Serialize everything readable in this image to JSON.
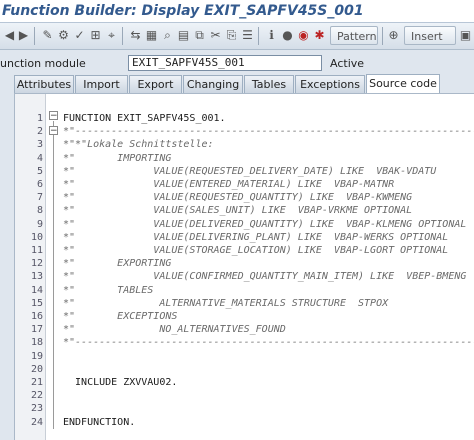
{
  "window": {
    "title": "Function Builder: Display EXIT_SAPFV45S_001"
  },
  "toolbar": {
    "icons": [
      "back-arrow-icon",
      "forward-arrow-icon",
      "display-change-icon",
      "activate-icon",
      "check-icon",
      "object-list-icon",
      "where-used-icon",
      "navigate-icon",
      "pretty-printer-icon",
      "find-icon",
      "insert-statement-icon",
      "copy-icon",
      "cut-icon",
      "paste-icon",
      "stack-icon",
      "info-icon",
      "breakpoint-icon",
      "watchpoint-icon",
      "enhance-icon"
    ],
    "pattern_label": "Pattern",
    "insert_label": "Insert"
  },
  "function_module": {
    "label": "unction module",
    "value": "EXIT_SAPFV45S_001",
    "status": "Active"
  },
  "tabs": [
    {
      "label": "Attributes",
      "active": false
    },
    {
      "label": "Import",
      "active": false
    },
    {
      "label": "Export",
      "active": false
    },
    {
      "label": "Changing",
      "active": false
    },
    {
      "label": "Tables",
      "active": false
    },
    {
      "label": "Exceptions",
      "active": false
    },
    {
      "label": "Source code",
      "active": true
    }
  ],
  "editor": {
    "lines": [
      {
        "n": "1",
        "text": "FUNCTION EXIT_SAPFV45S_001.",
        "type": "kw"
      },
      {
        "n": "2",
        "text": "*\"-------------------------------------------------------------------",
        "type": "comment"
      },
      {
        "n": "3",
        "text": "*\"*\"Lokale Schnittstelle:",
        "type": "comment"
      },
      {
        "n": "4",
        "text": "*\"       IMPORTING",
        "type": "comment"
      },
      {
        "n": "5",
        "text": "*\"             VALUE(REQUESTED_DELIVERY_DATE) LIKE  VBAK-VDATU",
        "type": "comment"
      },
      {
        "n": "6",
        "text": "*\"             VALUE(ENTERED_MATERIAL) LIKE  VBAP-MATNR",
        "type": "comment"
      },
      {
        "n": "7",
        "text": "*\"             VALUE(REQUESTED_QUANTITY) LIKE  VBAP-KWMENG",
        "type": "comment"
      },
      {
        "n": "8",
        "text": "*\"             VALUE(SALES_UNIT) LIKE  VBAP-VRKME OPTIONAL",
        "type": "comment"
      },
      {
        "n": "9",
        "text": "*\"             VALUE(DELIVERED_QUANTITY) LIKE  VBAP-KLMENG OPTIONAL",
        "type": "comment"
      },
      {
        "n": "10",
        "text": "*\"             VALUE(DELIVERING_PLANT) LIKE  VBAP-WERKS OPTIONAL",
        "type": "comment"
      },
      {
        "n": "11",
        "text": "*\"             VALUE(STORAGE_LOCATION) LIKE  VBAP-LGORT OPTIONAL",
        "type": "comment"
      },
      {
        "n": "12",
        "text": "*\"       EXPORTING",
        "type": "comment"
      },
      {
        "n": "13",
        "text": "*\"             VALUE(CONFIRMED_QUANTITY_MAIN_ITEM) LIKE  VBEP-BMENG",
        "type": "comment"
      },
      {
        "n": "14",
        "text": "*\"       TABLES",
        "type": "comment"
      },
      {
        "n": "15",
        "text": "*\"              ALTERNATIVE_MATERIALS STRUCTURE  STPOX",
        "type": "comment"
      },
      {
        "n": "16",
        "text": "*\"       EXCEPTIONS",
        "type": "comment"
      },
      {
        "n": "17",
        "text": "*\"              NO_ALTERNATIVES_FOUND",
        "type": "comment"
      },
      {
        "n": "18",
        "text": "*\"-------------------------------------------------------------------",
        "type": "comment"
      },
      {
        "n": "19",
        "text": "",
        "type": "kw"
      },
      {
        "n": "20",
        "text": "",
        "type": "kw"
      },
      {
        "n": "21",
        "text": "  INCLUDE ZXVVAU02.",
        "type": "kw"
      },
      {
        "n": "22",
        "text": "",
        "type": "kw"
      },
      {
        "n": "23",
        "text": "",
        "type": "kw"
      },
      {
        "n": "24",
        "text": "ENDFUNCTION.",
        "type": "kw"
      }
    ]
  }
}
